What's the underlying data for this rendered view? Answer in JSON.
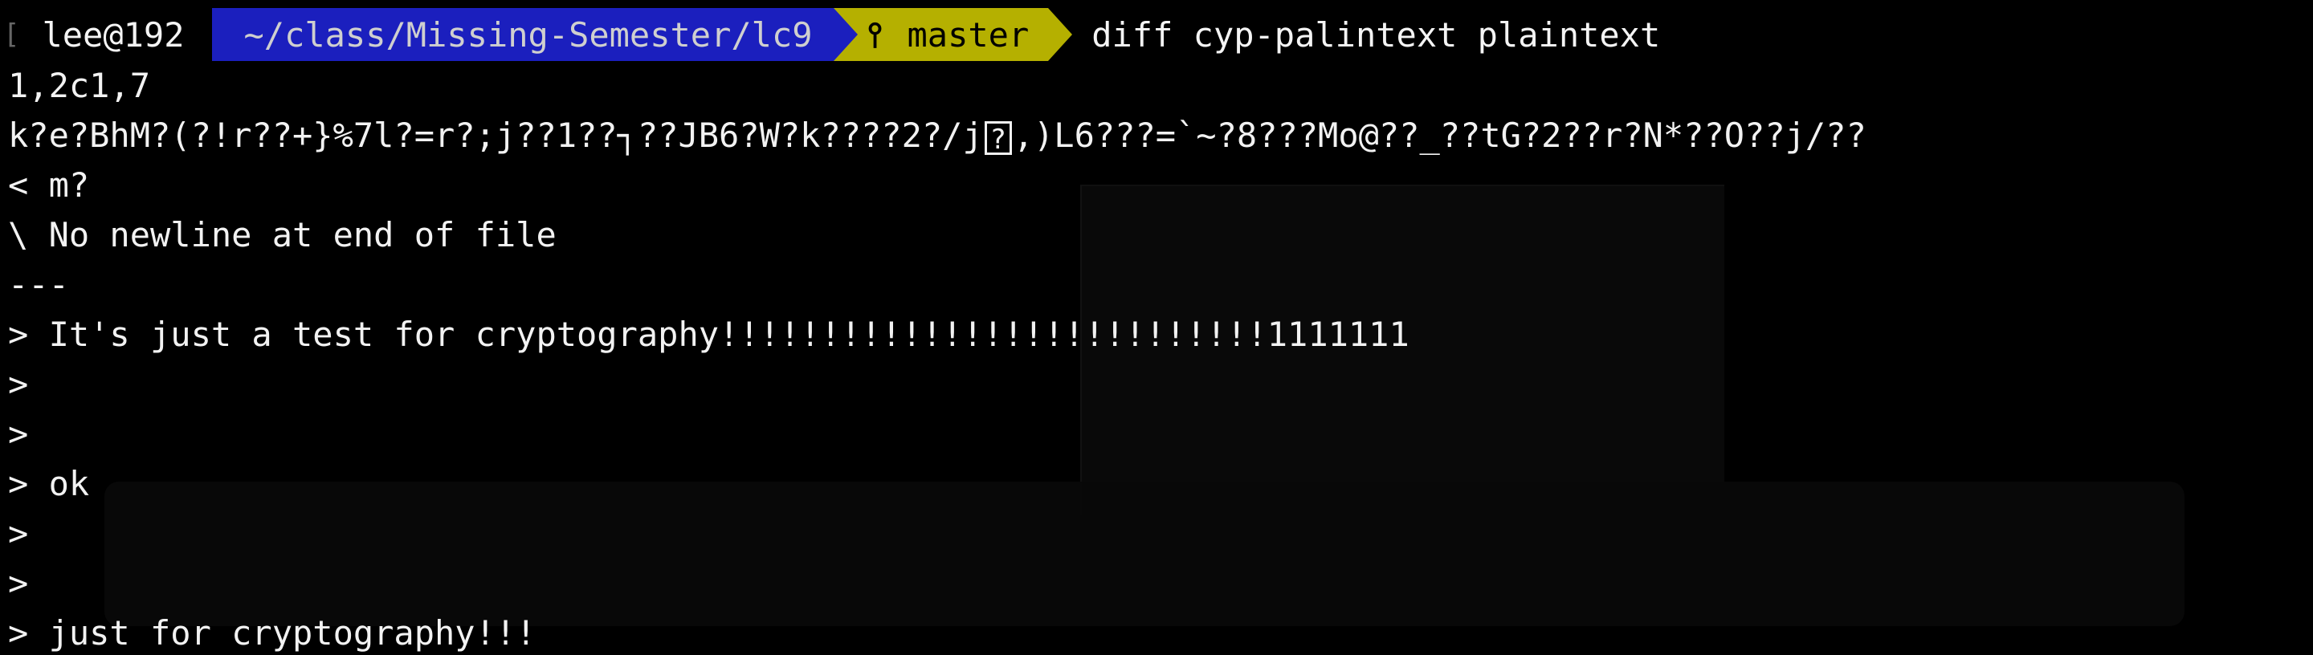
{
  "terminal": {
    "prompt": {
      "user_host": "lee@192",
      "path": "~/class/Missing-Semester/lc9",
      "branch_icon": "git-branch-icon",
      "branch": "master",
      "command": "diff cyp-palintext plaintext"
    },
    "output_lines": [
      "1,2c1,7",
      "k?e?BhM?(?!r??+}%7l?=r?;j??1??┐??JB6?W?k????2?/j",
      "< m?",
      "\\ No newline at end of file",
      "---",
      "> It's just a test for cryptography!!!!!!!!!!!!!!!!!!!!!!!!!!!1111111",
      ">",
      ">",
      "> ok",
      ">",
      ">",
      "> just for cryptography!!!"
    ],
    "line2_box_glyph": "?",
    "line2_tail": ",)L6???=`~?8???Mo@??_??tG?2??r?N*??O??j/??",
    "colors": {
      "background": "#000000",
      "path_segment": "#1b1fbe",
      "git_segment": "#b5b000",
      "text": "#f2f2f2"
    }
  }
}
